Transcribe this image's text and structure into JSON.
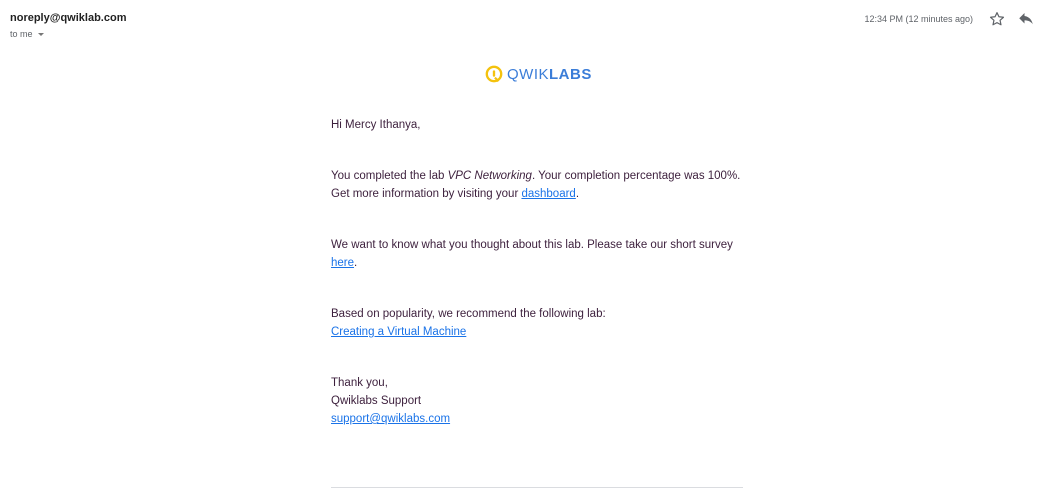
{
  "header": {
    "sender": "noreply@qwiklab.com",
    "recipient_label": "to me",
    "timestamp": "12:34 PM (12 minutes ago)",
    "star_icon": "star-icon",
    "reply_icon": "reply-icon"
  },
  "logo": {
    "text_light": "QWIK",
    "text_bold": "LABS",
    "mark_color": "#f4c20d",
    "text_color": "#3b7dd8"
  },
  "body": {
    "greeting": "Hi Mercy Ithanya,",
    "completion": {
      "prefix": "You completed the lab ",
      "lab_name": "VPC Networking",
      "middle": ". Your completion percentage was 100%. Get more information by visiting your ",
      "link": "dashboard",
      "suffix": "."
    },
    "survey": {
      "prefix": "We want to know what you thought about this lab. Please take our short survey ",
      "link": "here",
      "suffix": "."
    },
    "recommendation": {
      "text": "Based on popularity, we recommend the following lab:",
      "link": "Creating a Virtual Machine"
    },
    "signoff": {
      "thanks": "Thank you,",
      "team": "Qwiklabs Support",
      "email": "support@qwiklabs.com"
    }
  },
  "colors": {
    "link": "#1a73e8",
    "body_text": "#3c1f3c"
  }
}
